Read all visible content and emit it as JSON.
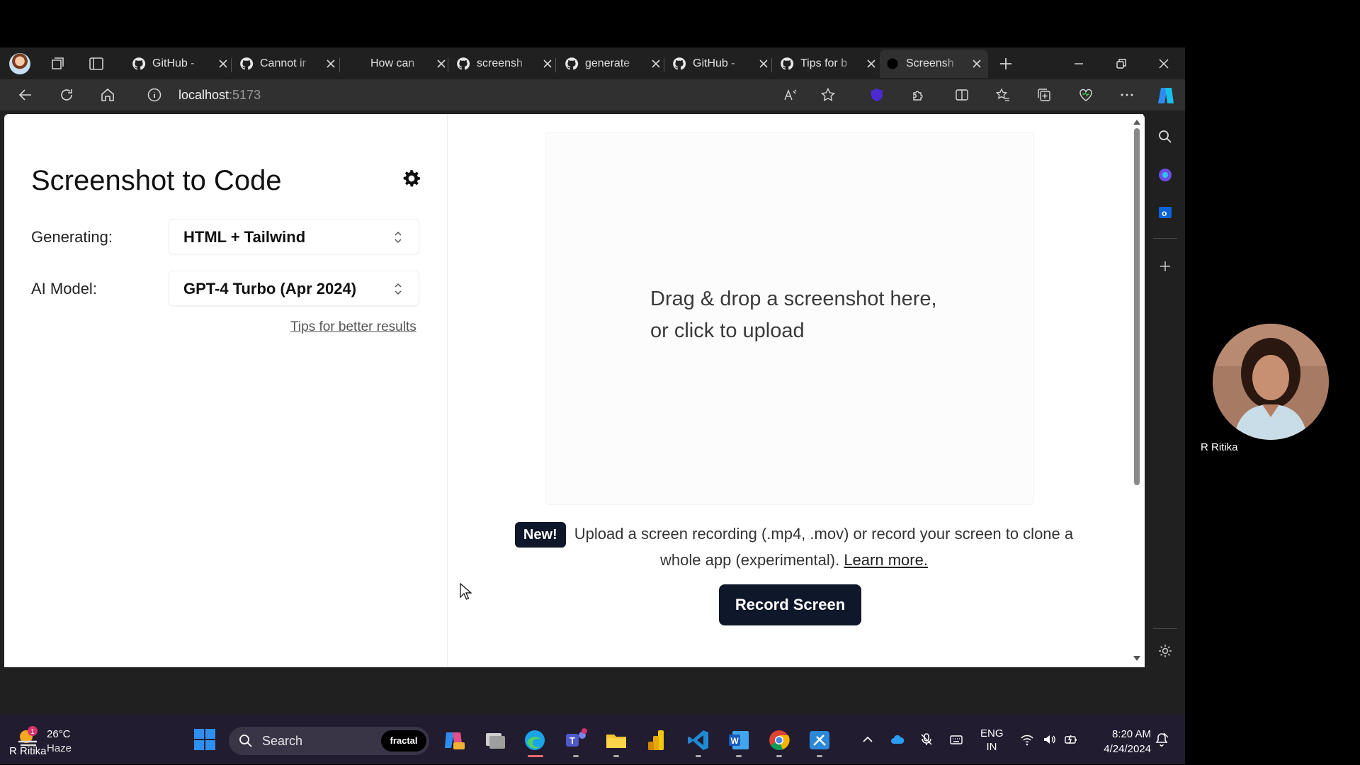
{
  "browser": {
    "tabs": [
      {
        "title": "GitHub -",
        "favicon": "github-icon"
      },
      {
        "title": "Cannot ir",
        "favicon": "github-icon"
      },
      {
        "title": "How can",
        "favicon": "none"
      },
      {
        "title": "screensh",
        "favicon": "github-icon"
      },
      {
        "title": "generate",
        "favicon": "github-icon"
      },
      {
        "title": "GitHub -",
        "favicon": "github-icon"
      },
      {
        "title": "Tips for b",
        "favicon": "github-icon"
      },
      {
        "title": "Screensh",
        "favicon": "dot-icon",
        "active": true
      }
    ],
    "url_host": "localhost",
    "url_port": ":5173"
  },
  "app": {
    "title": "Screenshot to Code",
    "generating_label": "Generating:",
    "generating_value": "HTML + Tailwind",
    "model_label": "AI Model:",
    "model_value": "GPT-4 Turbo (Apr 2024)",
    "tips_link": "Tips for better results",
    "dropzone_line1": "Drag & drop a screenshot here,",
    "dropzone_line2": "or click to upload",
    "new_badge": "New!",
    "new_text_1": "Upload a screen recording (.mp4, .mov) or record your screen to clone a",
    "new_text_2": "whole app (experimental).",
    "learn_more": "Learn more.",
    "record_button": "Record Screen"
  },
  "taskbar": {
    "weather_temp": "26°C",
    "weather_desc": "Haze",
    "weather_alert": "1",
    "search_placeholder": "Search",
    "search_badge": "fractal",
    "lang_line1": "ENG",
    "lang_line2": "IN",
    "time": "8:20 AM",
    "date": "4/24/2024"
  },
  "meeting": {
    "participant_name": "R Ritika",
    "presenter_name": "R Ritika"
  },
  "colors": {
    "accent_dark": "#0f172a",
    "browser_chrome": "#202020",
    "taskbar": "#221c30"
  }
}
